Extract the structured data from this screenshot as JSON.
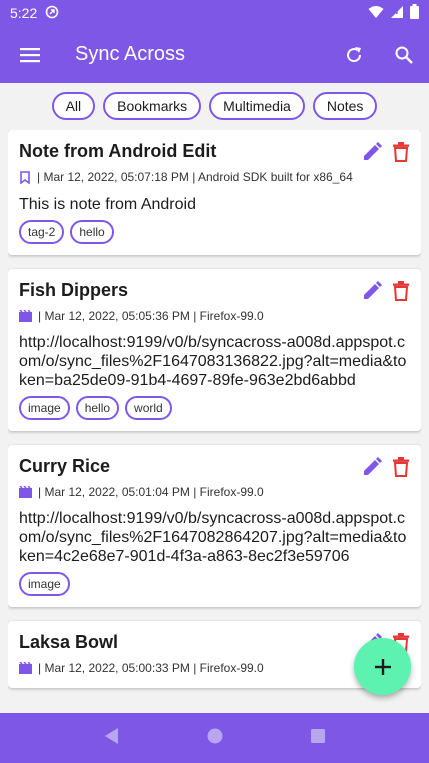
{
  "status": {
    "time": "5:22"
  },
  "app_bar": {
    "title": "Sync Across"
  },
  "filters": [
    "All",
    "Bookmarks",
    "Multimedia",
    "Notes"
  ],
  "cards": [
    {
      "title": "Note from Android Edit",
      "type_icon": "bookmark-icon",
      "meta": "| Mar 12, 2022, 05:07:18 PM | Android SDK built for x86_64",
      "body": "This is note from Android",
      "tags": [
        "tag-2",
        "hello"
      ]
    },
    {
      "title": "Fish Dippers",
      "type_icon": "movie-icon",
      "meta": "| Mar 12, 2022, 05:05:36 PM | Firefox-99.0",
      "body": "http://localhost:9199/v0/b/syncacross-a008d.appspot.com/o/sync_files%2F1647083136822.jpg?alt=media&token=ba25de09-91b4-4697-89fe-963e2bd6abbd",
      "tags": [
        "image",
        "hello",
        "world"
      ]
    },
    {
      "title": "Curry Rice",
      "type_icon": "movie-icon",
      "meta": "| Mar 12, 2022, 05:01:04 PM | Firefox-99.0",
      "body": "http://localhost:9199/v0/b/syncacross-a008d.appspot.com/o/sync_files%2F1647082864207.jpg?alt=media&token=4c2e68e7-901d-4f3a-a863-8ec2f3e59706",
      "tags": [
        "image"
      ]
    },
    {
      "title": "Laksa Bowl",
      "type_icon": "movie-icon",
      "meta": "| Mar 12, 2022, 05:00:33 PM | Firefox-99.0",
      "body": "",
      "tags": []
    }
  ],
  "colors": {
    "primary": "#7e57e6",
    "fab": "#5ef2b0",
    "delete": "#e53935",
    "edit": "#7e57e6"
  }
}
